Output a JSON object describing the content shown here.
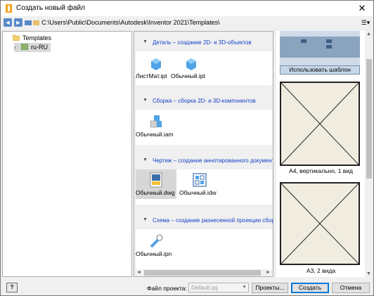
{
  "window": {
    "title": "Создать новый файл",
    "close_glyph": "✕"
  },
  "path": {
    "text": "C:\\Users\\Public\\Documents\\Autodesk\\Inventor 2021\\Templates\\",
    "back": "◄",
    "forward": "►",
    "view_glyph": "☰▾"
  },
  "tree": {
    "items": [
      {
        "label": "Templates",
        "expander": "",
        "icon": "folder-icon"
      },
      {
        "label": "ru-RU",
        "expander": "›",
        "icon": "folder-green-icon"
      }
    ]
  },
  "sections": [
    {
      "label": "Деталь – создание 2D- и 3D-объектов",
      "toggle": "▼",
      "files": [
        "ЛистМат.ipt",
        "Обычный.ipt"
      ]
    },
    {
      "label": "Сборка – сборка 2D- и 3D-компонентов",
      "toggle": "▼",
      "files": [
        "Обычный.iam"
      ]
    },
    {
      "label": "Чертеж – создание аннотированного документа",
      "toggle": "▼",
      "files": [
        "Обычный.dwg",
        "Обычный.idw"
      ]
    },
    {
      "label": "Схема – создание разнесенной проекции сборки",
      "toggle": "▼",
      "files": [
        "Обычный.ipn"
      ]
    }
  ],
  "preview": {
    "use_template_button": "Использовать шаблон",
    "sheets": [
      "А4, вертикально, 1 вид",
      "А3, 2 вида"
    ]
  },
  "scrollbars": {
    "left": "◄",
    "right": "►",
    "up": "▲",
    "down": "▼"
  },
  "footer": {
    "help": "?",
    "project_label": "Файл проекта:",
    "project_value": "Default.ipj",
    "dropdown": "▼",
    "projects_button": "Проекты...",
    "create_button": "Создать",
    "cancel_button": "Отмена"
  },
  "colors": {
    "accent": "#0078d7",
    "section_label": "#1540c8",
    "part_blue": "#4fa3e6"
  }
}
